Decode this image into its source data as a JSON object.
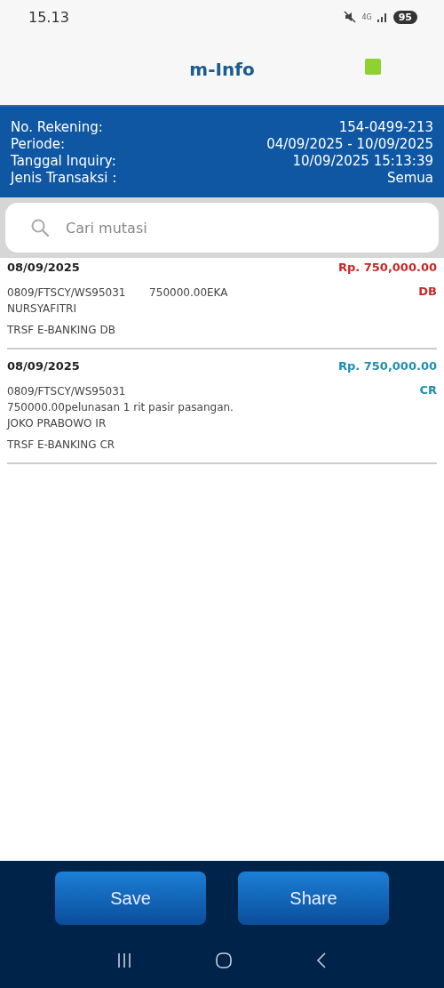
{
  "status_bar": {
    "time": "15.13",
    "network": "4G",
    "battery": "95"
  },
  "header": {
    "title": "m-Info"
  },
  "account_info": [
    {
      "label": "No. Rekening:",
      "value": "154-0499-213"
    },
    {
      "label": "Periode:",
      "value": "04/09/2025 - 10/09/2025"
    },
    {
      "label": "Tanggal Inquiry:",
      "value": "10/09/2025 15:13:39"
    },
    {
      "label": "Jenis Transaksi :",
      "value": "Semua"
    }
  ],
  "search": {
    "placeholder": "Cari mutasi"
  },
  "transactions": [
    {
      "kind": "db",
      "date": "08/09/2025",
      "amount": "Rp. 750,000.00",
      "type": "DB",
      "lines": [
        "0809/FTSCY/WS95031       750000.00EKA",
        "NURSYAFITRI"
      ],
      "channel": "TRSF E-BANKING DB"
    },
    {
      "kind": "cr",
      "date": "08/09/2025",
      "amount": "Rp. 750,000.00",
      "type": "CR",
      "lines": [
        "0809/FTSCY/WS95031",
        "750000.00pelunasan 1 rit pasir pasangan.",
        "JOKO PRABOWO IR"
      ],
      "channel": "TRSF E-BANKING CR"
    }
  ],
  "buttons": [
    "Save",
    "Share"
  ]
}
